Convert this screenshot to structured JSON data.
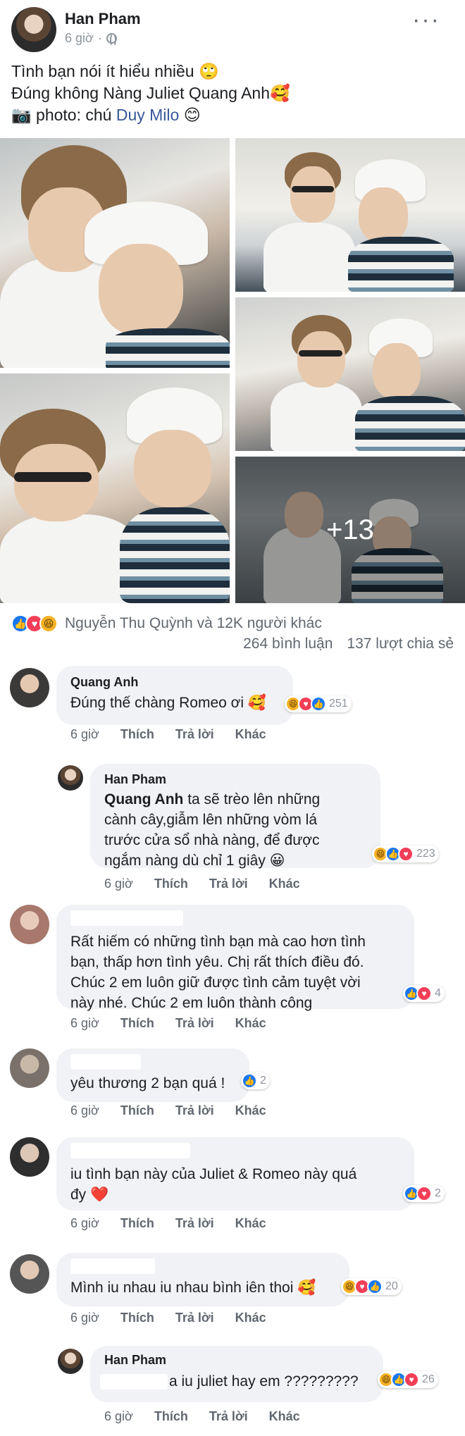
{
  "post": {
    "author": "Han Pham",
    "time": "6 giờ",
    "lines": [
      "Tình bạn nói ít hiểu nhiều 🙄",
      "Đúng không Nàng Juliet Quang Anh🥰"
    ],
    "photo_prefix": "📷 photo: chú ",
    "photo_credit": "Duy Milo",
    "photo_suffix": " 😊",
    "more_photos": "+13"
  },
  "summary": {
    "reactors": "Nguyễn Thu Quỳnh và 12K người khác",
    "comments": "264 bình luận",
    "shares": "137 lượt chia sẻ"
  },
  "actions": {
    "like": "Thích",
    "reply": "Trả lời",
    "more": "Khác"
  },
  "comments": [
    {
      "name": "Quang Anh",
      "text": [
        "Đúng thế chàng Romeo ơi 🥰"
      ],
      "time": "6 giờ",
      "reactions": {
        "count": "251"
      }
    },
    {
      "name": "Han Pham",
      "mention": "Quang Anh",
      "text": [
        " ta sẽ trèo lên những",
        "cành cây,giẫm lên những vòm lá",
        "trước cửa sổ nhà nàng, để được",
        "ngắm nàng dù chỉ 1 giây 😀"
      ],
      "time": "6 giờ",
      "reactions": {
        "count": "223"
      }
    },
    {
      "text": [
        "Rất hiếm có những tình bạn mà cao hơn tình",
        "bạn, thấp hơn tình yêu. Chị rất thích điều đó.",
        "Chúc 2 em luôn giữ được tình cảm tuyệt vời",
        "này nhé. Chúc 2 em luôn thành công"
      ],
      "time": "6 giờ",
      "reactions": {
        "count": "4"
      }
    },
    {
      "text": [
        "yêu thương 2 bạn quá !"
      ],
      "time": "6 giờ",
      "reactions": {
        "count": "2"
      }
    },
    {
      "text": [
        "iu tình bạn này của Juliet & Romeo này quá",
        "đy"
      ],
      "heart": "❤️",
      "time": "6 giờ",
      "reactions": {
        "count": "2"
      }
    },
    {
      "text": [
        "Mình iu nhau iu nhau bình iên thoi 🥰"
      ],
      "time": "6 giờ",
      "reactions": {
        "count": "20"
      }
    },
    {
      "name": "Han Pham",
      "text": [
        "a iu juliet hay em ?????????"
      ],
      "time": "6 giờ",
      "reactions": {
        "count": "26"
      }
    }
  ]
}
